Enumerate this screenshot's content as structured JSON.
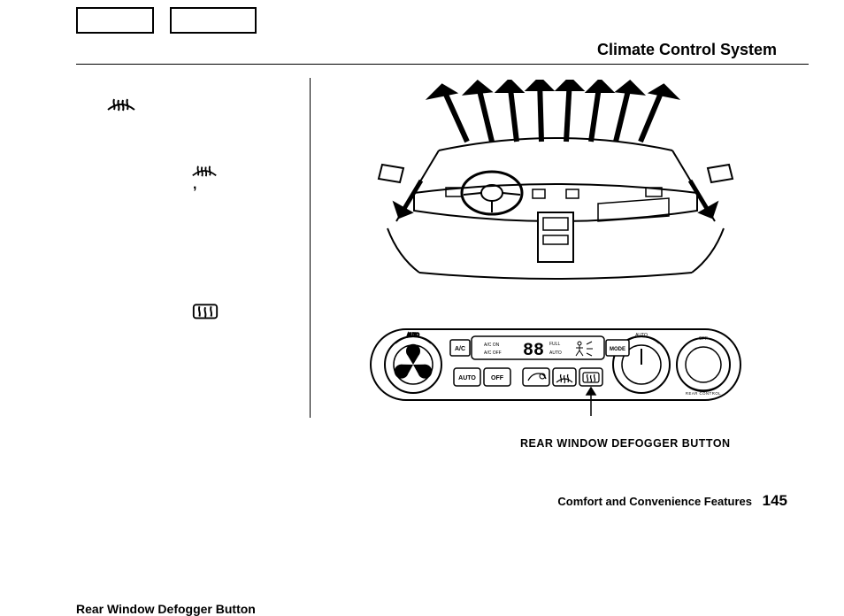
{
  "header": {
    "title": "Climate Control System"
  },
  "left": {
    "subheading": "Rear Window Defogger Button"
  },
  "panel": {
    "caption": "REAR WINDOW DEFOGGER BUTTON",
    "buttons": {
      "ac": "A/C",
      "auto": "AUTO",
      "off": "OFF",
      "mode": "MODE"
    },
    "display": {
      "acon": "A/C ON",
      "acoff": "A/C OFF",
      "full": "FULL",
      "auto": "AUTO",
      "digits": "88"
    },
    "rear_label_top": "OFF",
    "rear_label_bottom": "REAR CONTROL",
    "fan_auto": "AUTO"
  },
  "footer": {
    "section": "Comfort and Convenience Features",
    "page": "145"
  }
}
